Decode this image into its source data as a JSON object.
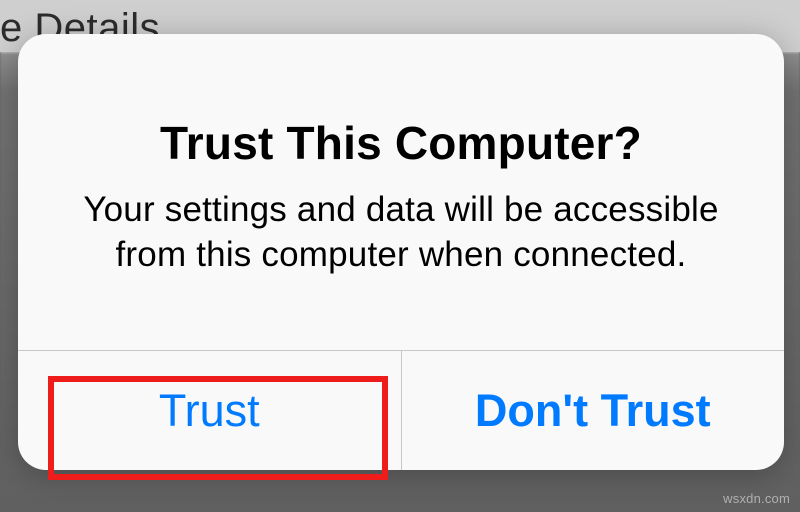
{
  "background": {
    "partial_text": "e Details"
  },
  "dialog": {
    "title": "Trust This Computer?",
    "message": "Your settings and data will be accessible from this computer when connected.",
    "buttons": {
      "trust": "Trust",
      "dont_trust": "Don't Trust"
    }
  },
  "watermark": "wsxdn.com"
}
